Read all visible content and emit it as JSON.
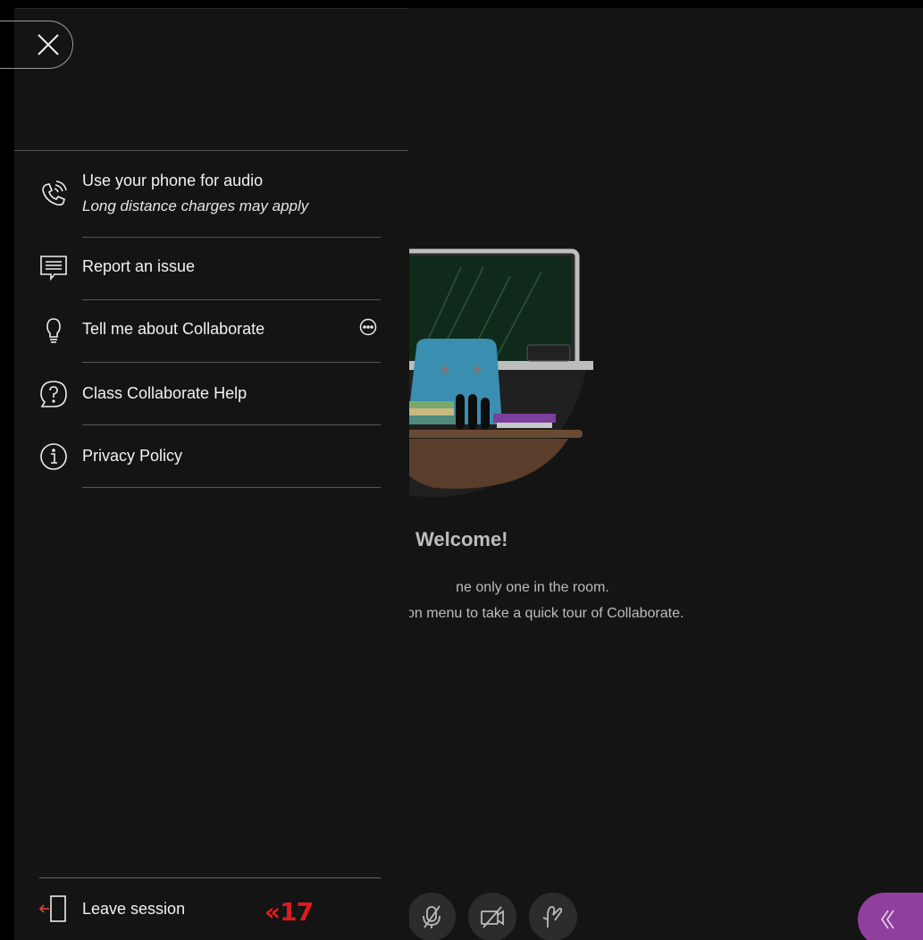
{
  "welcome": {
    "title": "Welcome!",
    "line1": "ne only one in the room.",
    "line2": "ession menu to take a quick tour of Collaborate."
  },
  "session_menu": {
    "items": [
      {
        "label": "Use your phone for audio",
        "sublabel": "Long distance charges may apply",
        "icon": "phone-icon"
      },
      {
        "label": "Report an issue",
        "icon": "report-icon"
      },
      {
        "label": "Tell me about Collaborate",
        "icon": "lightbulb-icon"
      },
      {
        "label": "Class Collaborate Help",
        "icon": "help-icon"
      },
      {
        "label": "Privacy Policy",
        "icon": "info-icon"
      }
    ],
    "leave_label": "Leave session"
  },
  "annotation": {
    "text": "«17"
  },
  "controls": {
    "microphone": "microphone-muted-icon",
    "camera": "camera-off-icon",
    "raise_hand": "raise-hand-icon",
    "expand_panel": "chevron-left-icon"
  },
  "colors": {
    "background": "#141414",
    "panel_accent": "#8f3f9c",
    "annotation": "#e01b1b"
  }
}
